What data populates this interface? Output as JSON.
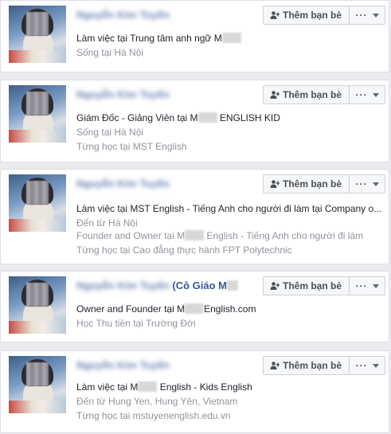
{
  "results": [
    {
      "name": "Nguyễn Kim Tuyến",
      "name_suffix": "",
      "lines": [
        {
          "text": "Làm việc tại Trung tâm anh ngữ M",
          "style": "main",
          "redact_after": true
        },
        {
          "text": "Sống tại Hà Nội",
          "style": "sub"
        }
      ]
    },
    {
      "name": "Nguyễn Kim Tuyến",
      "name_suffix": "",
      "lines": [
        {
          "text": "Giám Đốc - Giảng Viên tại M",
          "style": "main",
          "redact_after": true,
          "tail": " ENGLISH KID"
        },
        {
          "text": "Sống tại Hà Nội",
          "style": "sub"
        },
        {
          "text": "Từng học tại MST English",
          "style": "sub"
        }
      ]
    },
    {
      "name": "Nguyễn Kim Tuyến",
      "name_suffix": "",
      "lines": [
        {
          "text": "Làm việc tại MST English - Tiếng Anh cho người đi làm tại Company o...",
          "style": "main"
        },
        {
          "text": "Đến từ Hà Nội",
          "style": "sub"
        },
        {
          "text": "Founder and Owner tại M",
          "style": "sub",
          "redact_after": true,
          "tail": " English - Tiếng Anh cho người đi làm"
        },
        {
          "text": "Từng học tại Cao đẳng thực hành FPT Polytechnic",
          "style": "sub"
        }
      ]
    },
    {
      "name": "Nguyễn Kim Tuyến",
      "name_suffix": " (Cô Giáo M",
      "lines": [
        {
          "text": "Owner and Founder tại M",
          "style": "main",
          "redact_after": true,
          "tail": "English.com"
        },
        {
          "text": "Học Thu tiền tại Trường Đời",
          "style": "sub"
        }
      ]
    },
    {
      "name": "Nguyễn Kim Tuyến",
      "name_suffix": "",
      "lines": [
        {
          "text": "Làm việc tại M",
          "style": "main",
          "redact_after": true,
          "tail": " English - Kids English"
        },
        {
          "text": "Đến từ Hung Yen, Hung Yên, Vietnam",
          "style": "sub"
        },
        {
          "text": "Từng học tại mstuyenenglish.edu.vn",
          "style": "sub"
        }
      ]
    }
  ],
  "add_friend_label": "Thêm bạn bè",
  "more_label": "···",
  "icons": {
    "add_friend": "person-plus-icon",
    "more": "dots-icon",
    "caret": "chevron-down-icon"
  },
  "colors": {
    "link": "#365899",
    "muted": "#90949c",
    "button_bg": "#f6f7f9",
    "border": "#dddfe2"
  }
}
